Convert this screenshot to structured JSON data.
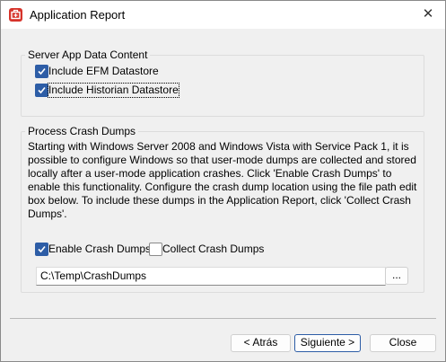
{
  "window": {
    "title": "Application Report",
    "close_glyph": "✕"
  },
  "server_group": {
    "label": "Server App Data Content",
    "options": [
      {
        "label": "Include EFM Datastore",
        "checked": true
      },
      {
        "label": "Include Historian Datastore",
        "checked": true
      }
    ]
  },
  "crash_group": {
    "label": "Process Crash Dumps",
    "description": "Starting with Windows Server 2008 and Windows Vista with Service Pack 1, it is possible to configure Windows so that user-mode dumps are collected and stored locally after a user-mode application crashes. Click 'Enable Crash Dumps' to enable this functionality. Configure the crash dump location using the file path edit box below. To include these dumps in the Application Report, click 'Collect Crash Dumps'.",
    "enable_label": "Enable Crash Dumps",
    "enable_checked": true,
    "collect_label": "Collect Crash Dumps",
    "collect_checked": false,
    "path_value": "C:\\Temp\\CrashDumps",
    "browse_label": "..."
  },
  "footer": {
    "back_label": "< Atrás",
    "next_label": "Siguiente >",
    "close_label": "Close"
  },
  "colors": {
    "accent": "#2d5da6",
    "icon": "#d6332a"
  }
}
